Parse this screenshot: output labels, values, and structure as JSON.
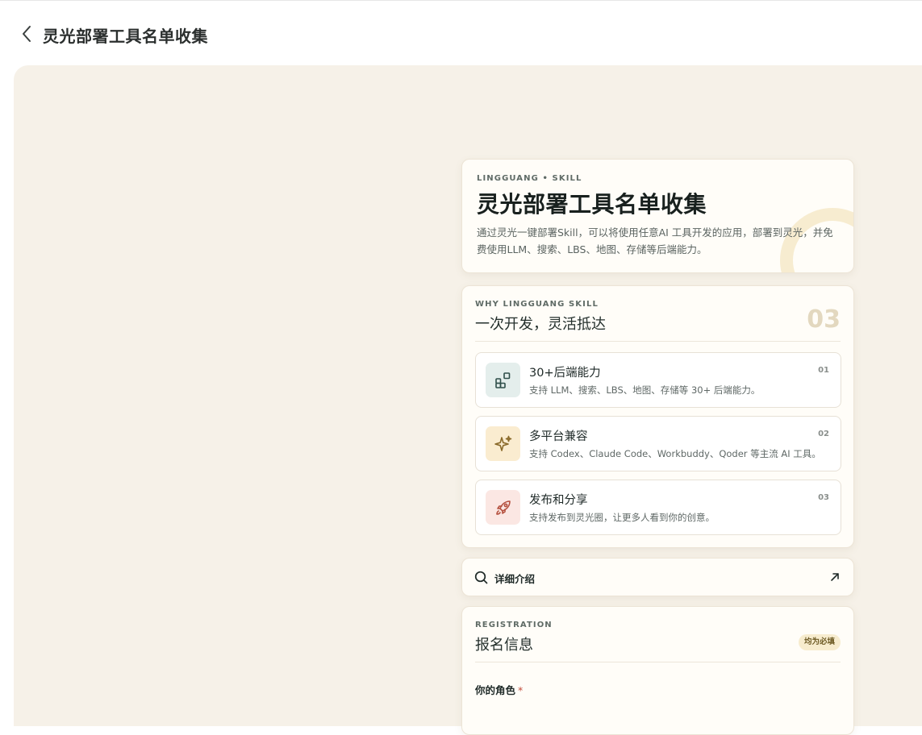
{
  "header": {
    "title": "灵光部署工具名单收集"
  },
  "hero": {
    "eyebrow": "LINGGUANG • SKILL",
    "title": "灵光部署工具名单收集",
    "description": "通过灵光一键部署Skill，可以将使用任意AI 工具开发的应用，部署到灵光，并免费使用LLM、搜索、LBS、地图、存储等后端能力。"
  },
  "why": {
    "eyebrow": "WHY LINGGUANG SKILL",
    "title": "一次开发，灵活抵达",
    "count": "03",
    "features": [
      {
        "title": "30+后端能力",
        "desc": "支持 LLM、搜索、LBS、地图、存储等 30+ 后端能力。",
        "num": "01",
        "icon": "blocks-icon",
        "icon_bg": "#e4eeec",
        "icon_color": "#2f4f4a"
      },
      {
        "title": "多平台兼容",
        "desc": "支持 Codex、Claude Code、Workbuddy、Qoder 等主流 AI 工具。",
        "num": "02",
        "icon": "sparkle-icon",
        "icon_bg": "#faecd0",
        "icon_color": "#8a6a2a"
      },
      {
        "title": "发布和分享",
        "desc": "支持发布到灵光圈，让更多人看到你的创意。",
        "num": "03",
        "icon": "rocket-icon",
        "icon_bg": "#fbe7e3",
        "icon_color": "#b5513f"
      }
    ]
  },
  "detail_link": {
    "label": "详细介绍"
  },
  "registration": {
    "eyebrow": "REGISTRATION",
    "title": "报名信息",
    "badge": "均为必填",
    "role_label": "你的角色",
    "required_mark": "*"
  }
}
